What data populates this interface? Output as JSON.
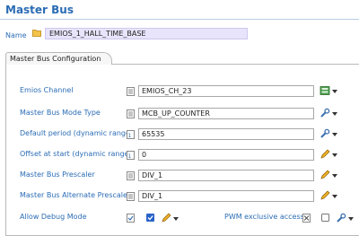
{
  "header": {
    "title": "Master Bus"
  },
  "name": {
    "label": "Name",
    "value": "EMIOS_1_HALL_TIME_BASE"
  },
  "tab": {
    "label": "Master Bus Configuration"
  },
  "fields": [
    {
      "label": "Emios Channel",
      "value": "EMIOS_CH_23"
    },
    {
      "label": "Master Bus Mode Type",
      "value": "MCB_UP_COUNTER"
    },
    {
      "label": "Default period (dynamic range)",
      "value": "65535"
    },
    {
      "label": "Offset at start (dynamic range)",
      "value": "0"
    },
    {
      "label": "Master Bus Prescaler",
      "value": "DIV_1"
    },
    {
      "label": "Master Bus Alternate Prescaler",
      "value": "DIV_1"
    }
  ],
  "debug": {
    "label": "Allow Debug Mode",
    "checked": true
  },
  "pwm": {
    "label": "PWM exclusive access",
    "checked": false
  },
  "colors": {
    "label_blue": "#2b6cb5",
    "name_bg": "#e8e4fb",
    "checkbox_blue": "#2962c9"
  }
}
